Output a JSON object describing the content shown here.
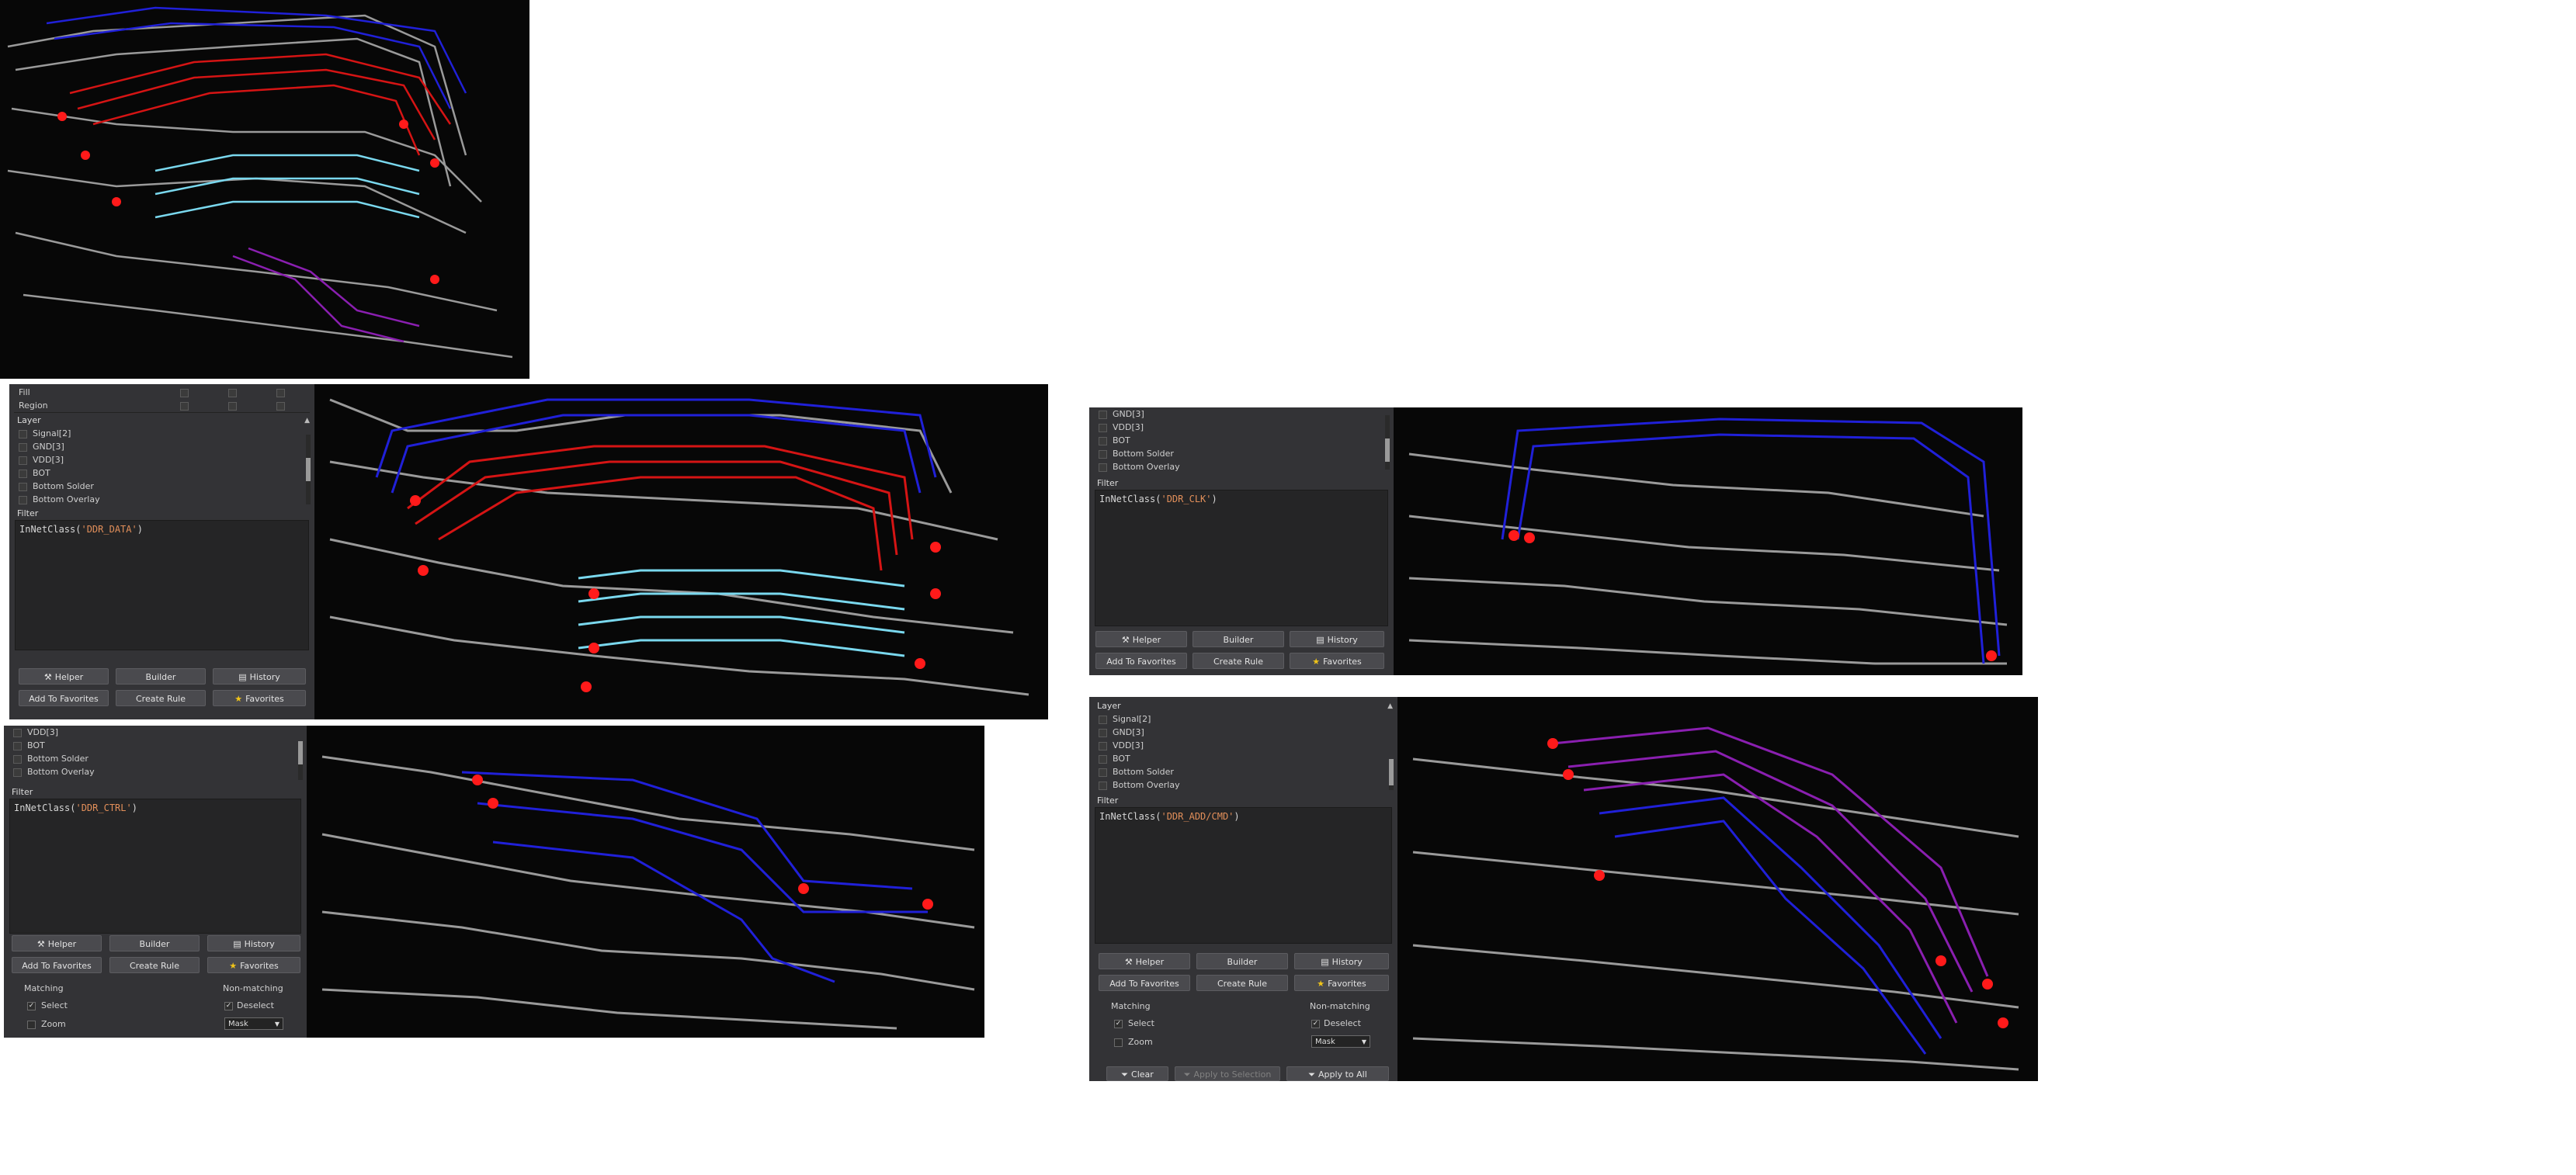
{
  "colors": {
    "pcb_bg": "#070707",
    "trace_gray": "#9a9a9a",
    "trace_red": "#d51414",
    "trace_blue": "#2020d8",
    "trace_cyan": "#7ad8ee",
    "trace_purple": "#8a1fb0",
    "via_red": "#ff1a1a",
    "panel_bg": "#333336",
    "filter_string": "#e28f5a"
  },
  "icons": {
    "helper": "wand-icon",
    "history": "folder-history-icon",
    "favorites": "star-icon",
    "clear": "funnel-icon",
    "apply": "funnel-icon"
  },
  "buttons": {
    "helper": "Helper",
    "builder": "Builder",
    "history": "History",
    "add_to_favorites": "Add To Favorites",
    "create_rule": "Create Rule",
    "favorites": "Favorites"
  },
  "options": {
    "matching": "Matching",
    "non_matching": "Non-matching",
    "select": "Select",
    "zoom": "Zoom",
    "deselect": "Deselect",
    "mask": "Mask"
  },
  "bottom_bar": {
    "clear": "Clear",
    "apply_to_selection": "Apply to Selection",
    "apply_to_all": "Apply to All"
  },
  "panel_data": {
    "fill_label": "Fill",
    "region_label": "Region",
    "layer_header": "Layer",
    "filter_header": "Filter",
    "layers": [
      "Signal[2]",
      "GND[3]",
      "VDD[3]",
      "BOT",
      "Bottom Solder",
      "Bottom Overlay"
    ],
    "filter_fn": "InNetClass(",
    "filter_close": ")",
    "expr": "'DDR_DATA'"
  },
  "panel_clk": {
    "filter_header": "Filter",
    "layers": [
      "GND[3]",
      "VDD[3]",
      "BOT",
      "Bottom Solder",
      "Bottom Overlay"
    ],
    "filter_fn": "InNetClass(",
    "filter_close": ")",
    "expr": "'DDR_CLK'"
  },
  "panel_ctrl": {
    "filter_header": "Filter",
    "layers": [
      "VDD[3]",
      "BOT",
      "Bottom Solder",
      "Bottom Overlay"
    ],
    "filter_fn": "InNetClass(",
    "filter_close": ")",
    "expr": "'DDR_CTRL'"
  },
  "panel_add": {
    "layer_header": "Layer",
    "filter_header": "Filter",
    "layers": [
      "Signal[2]",
      "GND[3]",
      "VDD[3]",
      "BOT",
      "Bottom Solder",
      "Bottom Overlay"
    ],
    "filter_fn": "InNetClass(",
    "filter_close": ")",
    "expr": "'DDR_ADD/CMD'"
  }
}
